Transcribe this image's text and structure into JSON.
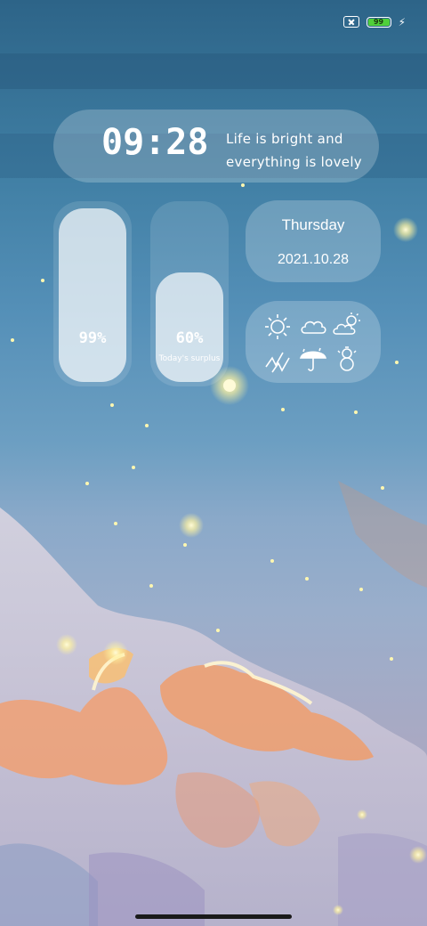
{
  "status_bar": {
    "battery_level": "99",
    "battery_color": "#4fcf3a",
    "icons": [
      "no-sim-icon",
      "battery-icon",
      "charging-bolt-icon"
    ]
  },
  "clock": {
    "time": "09:28",
    "quote_line1": "Life is bright and",
    "quote_line2": "everything is lovely"
  },
  "meters": [
    {
      "value": "99%",
      "level": 0.99,
      "caption": ""
    },
    {
      "value": "60%",
      "level": 0.6,
      "caption": "Today's surplus"
    }
  ],
  "date_card": {
    "day": "Thursday",
    "date": "2021.10.28"
  },
  "weather_icons": [
    "sunny-icon",
    "cloudy-icon",
    "partly-cloudy-icon",
    "thunder-icon",
    "rain-umbrella-icon",
    "snow-icon"
  ]
}
